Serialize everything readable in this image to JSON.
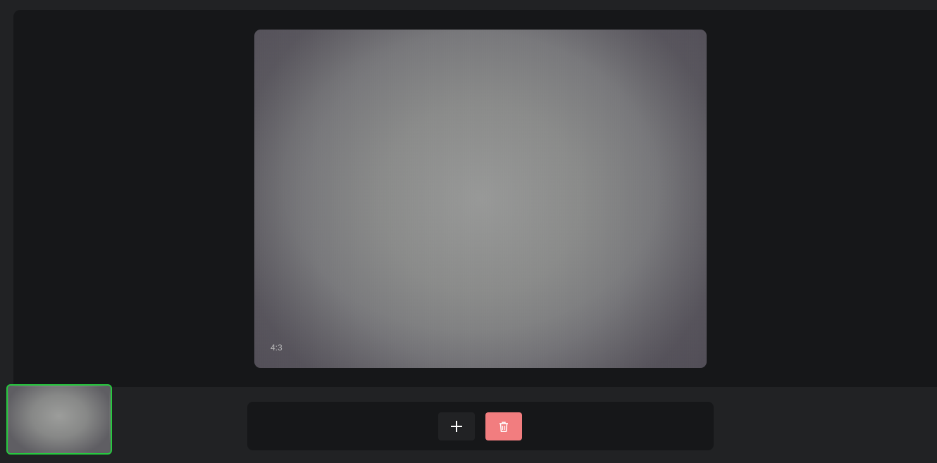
{
  "viewer": {
    "aspect_ratio_label": "4:3"
  },
  "toolbar": {
    "add_icon": "plus-icon",
    "delete_icon": "trash-icon"
  },
  "colors": {
    "background": "#212224",
    "panel": "#161719",
    "thumbnail_selected_border": "#27c93f",
    "delete_button": "#f27d7f",
    "add_button": "#212224"
  }
}
